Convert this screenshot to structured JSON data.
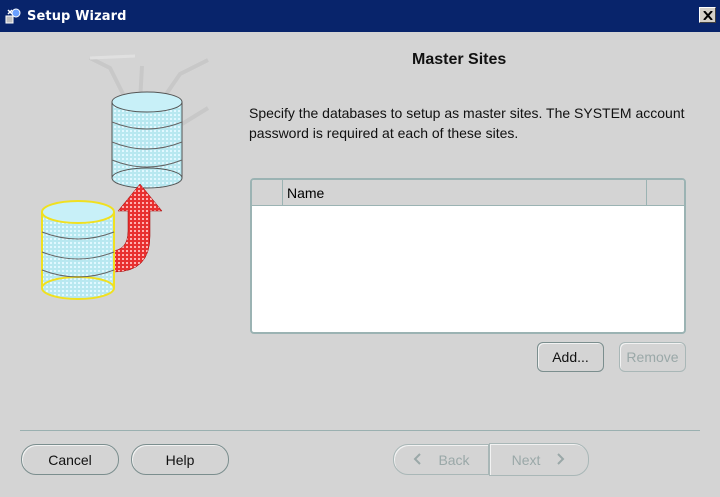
{
  "window": {
    "title": "Setup Wizard",
    "app_icon": "wizard-icon",
    "close_icon": "close-icon"
  },
  "page": {
    "heading": "Master Sites",
    "description": "Specify the databases to setup as master sites. The SYSTEM account password is required at each of these sites."
  },
  "table": {
    "columns": [
      "",
      "Name",
      ""
    ],
    "rows": []
  },
  "actions": {
    "add_label": "Add...",
    "remove_label": "Remove"
  },
  "footer": {
    "cancel_label": "Cancel",
    "help_label": "Help",
    "back_label": "Back",
    "next_label": "Next"
  },
  "colors": {
    "title_bar": "#08246b",
    "database": "#a8e0e8",
    "database_outline": "#f0e020",
    "arrow": "#e00000"
  }
}
